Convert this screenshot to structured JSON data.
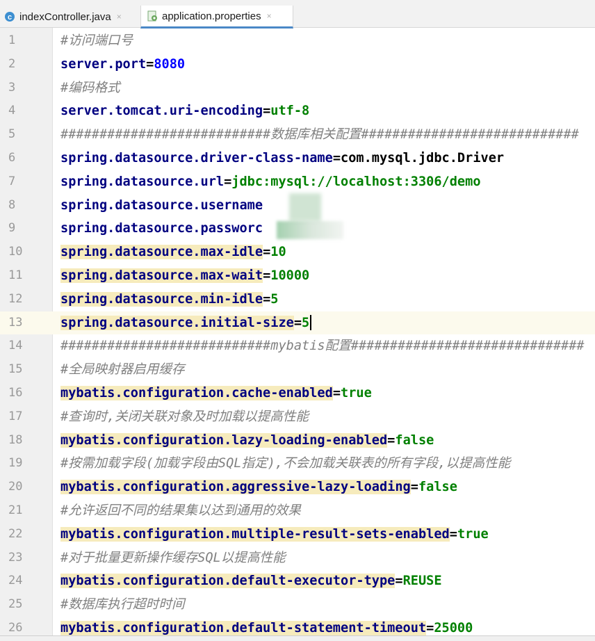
{
  "tabs": [
    {
      "label": "indexController.java",
      "icon": "java-class-icon",
      "active": false,
      "close": "×"
    },
    {
      "label": "application.properties",
      "icon": "properties-file-icon",
      "active": true,
      "close": "×"
    }
  ],
  "colors": {
    "key": "#000080",
    "value": "#008000",
    "comment": "#808080",
    "highlight": "#f6ebbc",
    "current_line": "#fcfaed",
    "tab_underline": "#4a88c7"
  },
  "editor": {
    "current_line": 13,
    "lines": [
      {
        "n": "1",
        "type": "comment",
        "text": "#访问端口号"
      },
      {
        "n": "2",
        "type": "prop",
        "key": "server.port",
        "eq": "=",
        "value": "8080",
        "value_color": "#0000ff"
      },
      {
        "n": "3",
        "type": "comment",
        "text": "#编码格式"
      },
      {
        "n": "4",
        "type": "prop",
        "key": "server.tomcat.uri-encoding",
        "eq": "=",
        "value": "utf-8"
      },
      {
        "n": "5",
        "type": "comment",
        "text": "###########################数据库相关配置############################"
      },
      {
        "n": "6",
        "type": "prop",
        "key": "spring.datasource.driver-class-name",
        "eq": "=",
        "value": "com.mysql.jdbc.Driver",
        "value_color": "#000000"
      },
      {
        "n": "7",
        "type": "prop",
        "key": "spring.datasource.url",
        "eq": "=",
        "value": "jdbc:mysql://localhost:3306/demo"
      },
      {
        "n": "8",
        "type": "prop",
        "key": "spring.datasource.username",
        "eq": "",
        "value": ""
      },
      {
        "n": "9",
        "type": "prop",
        "key": "spring.datasource.passworc",
        "eq": "",
        "value": ""
      },
      {
        "n": "10",
        "type": "prop",
        "key": "spring.datasource.max-idle",
        "eq": "=",
        "value": "10",
        "hl": true
      },
      {
        "n": "11",
        "type": "prop",
        "key": "spring.datasource.max-wait",
        "eq": "=",
        "value": "10000",
        "hl": true
      },
      {
        "n": "12",
        "type": "prop",
        "key": "spring.datasource.min-idle",
        "eq": "=",
        "value": "5",
        "hl": true
      },
      {
        "n": "13",
        "type": "prop",
        "key": "spring.datasource.initial-size",
        "eq": "=",
        "value": "5",
        "hl": true,
        "caret": true
      },
      {
        "n": "14",
        "type": "comment",
        "text": "###########################mybatis配置##############################"
      },
      {
        "n": "15",
        "type": "comment",
        "text": "#全局映射器启用缓存"
      },
      {
        "n": "16",
        "type": "prop",
        "key": "mybatis.configuration.cache-enabled",
        "eq": "=",
        "value": "true",
        "hl": true
      },
      {
        "n": "17",
        "type": "comment",
        "text": "#查询时,关闭关联对象及时加载以提高性能"
      },
      {
        "n": "18",
        "type": "prop",
        "key": "mybatis.configuration.lazy-loading-enabled",
        "eq": "=",
        "value": "false",
        "hl": true
      },
      {
        "n": "19",
        "type": "comment",
        "text": "#按需加载字段(加载字段由SQL指定),不会加载关联表的所有字段,以提高性能"
      },
      {
        "n": "20",
        "type": "prop",
        "key": "mybatis.configuration.aggressive-lazy-loading",
        "eq": "=",
        "value": "false",
        "hl": true
      },
      {
        "n": "21",
        "type": "comment",
        "text": "#允许返回不同的结果集以达到通用的效果"
      },
      {
        "n": "22",
        "type": "prop",
        "key": "mybatis.configuration.multiple-result-sets-enabled",
        "eq": "=",
        "value": "true",
        "hl": true
      },
      {
        "n": "23",
        "type": "comment",
        "text": "#对于批量更新操作缓存SQL以提高性能"
      },
      {
        "n": "24",
        "type": "prop",
        "key": "mybatis.configuration.default-executor-type",
        "eq": "=",
        "value": "REUSE",
        "hl": true
      },
      {
        "n": "25",
        "type": "comment",
        "text": "#数据库执行超时时间"
      },
      {
        "n": "26",
        "type": "prop",
        "key": "mybatis.configuration.default-statement-timeout",
        "eq": "=",
        "value": "25000",
        "hl": true
      }
    ]
  }
}
